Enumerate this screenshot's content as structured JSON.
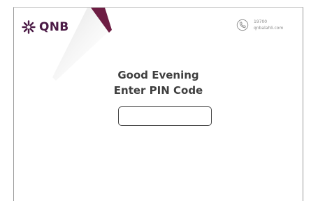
{
  "brand": {
    "name": "QNB",
    "logo_icon": "qnb-snowflake-logo-icon",
    "color": "#4b1b46"
  },
  "contact": {
    "phone_icon": "phone-icon",
    "phone": "19700",
    "website": "qnbalahli.com"
  },
  "main": {
    "greeting": "Good Evening",
    "prompt": "Enter PIN Code",
    "pin_input": {
      "value": "",
      "placeholder": ""
    }
  },
  "colors": {
    "accent": "#7a1f4a",
    "text": "#3f3f3f",
    "decor_gray": "#e6e6e6"
  }
}
